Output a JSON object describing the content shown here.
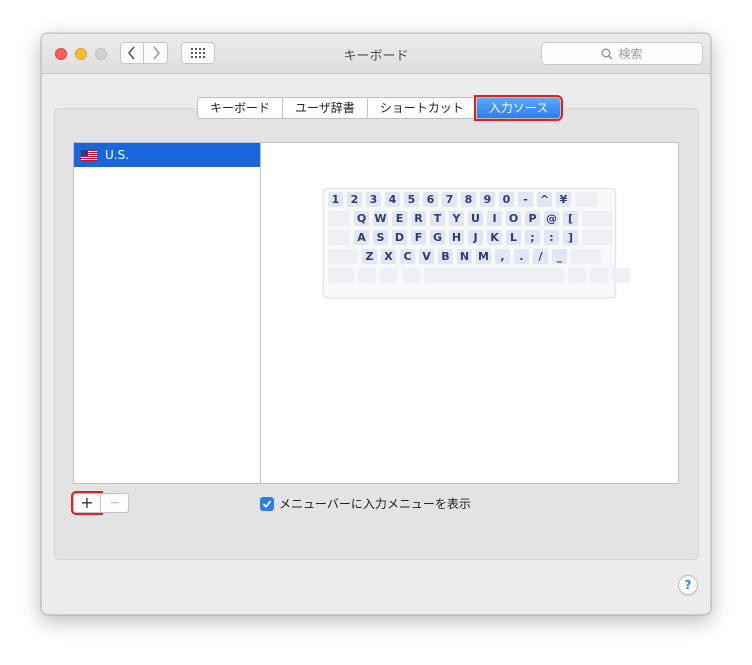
{
  "window": {
    "title": "キーボード",
    "search_placeholder": "検索"
  },
  "tabs": [
    {
      "label": "キーボード",
      "active": false
    },
    {
      "label": "ユーザ辞書",
      "active": false
    },
    {
      "label": "ショートカット",
      "active": false
    },
    {
      "label": "入力ソース",
      "active": true
    }
  ],
  "input_sources": [
    {
      "label": "U.S.",
      "icon": "us-flag-icon",
      "selected": true
    }
  ],
  "keyboard_preview": {
    "rows": [
      {
        "lead": 0,
        "keys": [
          "1",
          "2",
          "3",
          "4",
          "5",
          "6",
          "7",
          "8",
          "9",
          "0",
          "-",
          "^",
          "¥"
        ],
        "trail": 1
      },
      {
        "lead": 1,
        "keys": [
          "Q",
          "W",
          "E",
          "R",
          "T",
          "Y",
          "U",
          "I",
          "O",
          "P",
          "@",
          "["
        ],
        "trail": 1
      },
      {
        "lead": 1,
        "keys": [
          "A",
          "S",
          "D",
          "F",
          "G",
          "H",
          "J",
          "K",
          "L",
          ";",
          ":",
          "]"
        ],
        "trail": 1
      },
      {
        "lead": 1,
        "keys": [
          "Z",
          "X",
          "C",
          "V",
          "B",
          "N",
          "M",
          ",",
          ".",
          "/",
          "_"
        ],
        "trail": 1
      },
      {
        "lead": 0,
        "keys": [],
        "trail": 0
      }
    ]
  },
  "controls": {
    "add_symbol": "+",
    "remove_symbol": "−",
    "show_menu_label": "メニューバーに入力メニューを表示",
    "show_menu_checked": true,
    "help_symbol": "?"
  },
  "colors": {
    "accent": "#2a7ef1",
    "selection": "#1866dd",
    "highlight_box": "#e01f1f",
    "key_fill": "#e2e6f1",
    "key_text": "#2c3e70"
  }
}
